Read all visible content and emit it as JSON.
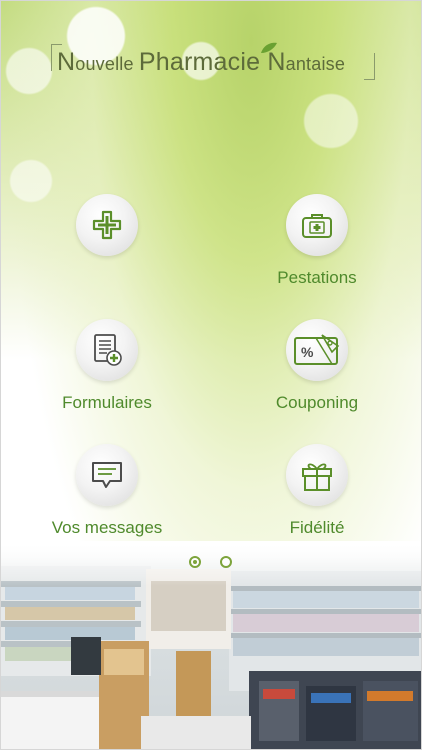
{
  "logo": {
    "n1": "N",
    "word1": "ouvelle ",
    "p": "P",
    "word2": "harmaci",
    "e": "e ",
    "n2": "N",
    "word3": "antaise"
  },
  "menu": [
    {
      "label": "",
      "icon": "medical-cross-icon"
    },
    {
      "label": "Pestations",
      "icon": "medical-kit-icon"
    },
    {
      "label": "Formulaires",
      "icon": "form-document-icon"
    },
    {
      "label": "Couponing",
      "icon": "coupon-ticket-icon"
    },
    {
      "label": "Vos messages",
      "icon": "message-bubble-icon"
    },
    {
      "label": "Fidélité",
      "icon": "gift-box-icon"
    }
  ],
  "pagination": {
    "pages": 2,
    "current": 1
  },
  "colors": {
    "accent": "#4f8a2c",
    "icon_green": "#5b8f2a",
    "dot": "#7da43c"
  }
}
